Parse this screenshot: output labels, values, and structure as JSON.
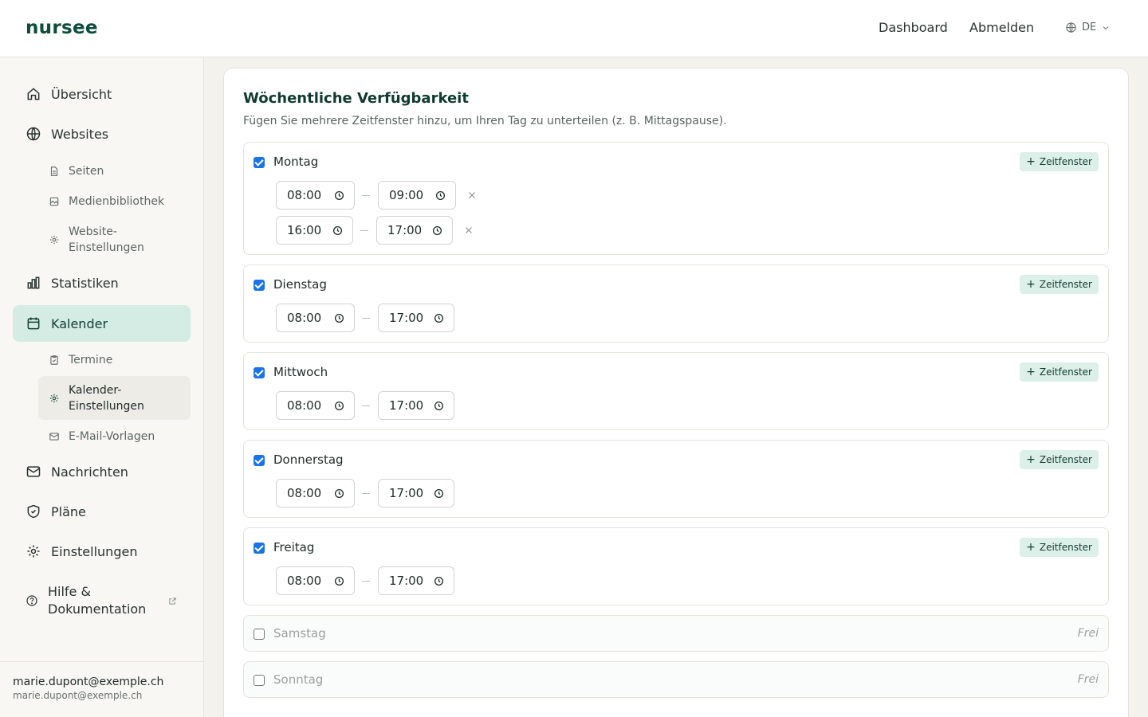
{
  "header": {
    "logo": "nursee",
    "nav": [
      {
        "label": "Dashboard"
      },
      {
        "label": "Abmelden"
      }
    ],
    "language": "DE"
  },
  "sidebar": {
    "items": [
      {
        "label": "Übersicht",
        "icon": "home-icon"
      },
      {
        "label": "Websites",
        "icon": "globe-icon"
      },
      {
        "label": "Seiten",
        "icon": "file-icon"
      },
      {
        "label": "Medienbibliothek",
        "icon": "image-icon"
      },
      {
        "label": "Website-",
        "label2": "Einstellungen",
        "icon": "gear-icon"
      },
      {
        "label": "Statistiken",
        "icon": "bar-chart-icon"
      },
      {
        "label": "Kalender",
        "icon": "calendar-icon"
      },
      {
        "label": "Termine",
        "icon": "clipboard-icon"
      },
      {
        "label": "Kalender-",
        "label2": "Einstellungen",
        "icon": "gear-icon"
      },
      {
        "label": "E-Mail-Vorlagen",
        "icon": "mail-icon"
      },
      {
        "label": "Nachrichten",
        "icon": "mail-icon"
      },
      {
        "label": "Pläne",
        "icon": "shield-icon"
      },
      {
        "label": "Einstellungen",
        "icon": "gear-icon"
      },
      {
        "label": "Hilfe &",
        "label2": "Dokumentation",
        "icon": "help-icon"
      }
    ],
    "user": {
      "name": "marie.dupont@exemple.ch",
      "email": "marie.dupont@exemple.ch"
    }
  },
  "availability": {
    "title": "Wöchentliche Verfügbarkeit",
    "subtitle": "Fügen Sie mehrere Zeitfenster hinzu, um Ihren Tag zu unterteilen (z. B. Mittagspause).",
    "add_label": "Zeitfenster",
    "off_label": "Frei",
    "days": [
      {
        "name": "Montag",
        "enabled": true,
        "slots": [
          {
            "start": "08:00",
            "end": "09:00"
          },
          {
            "start": "16:00",
            "end": "17:00"
          }
        ]
      },
      {
        "name": "Dienstag",
        "enabled": true,
        "slots": [
          {
            "start": "08:00",
            "end": "17:00"
          }
        ]
      },
      {
        "name": "Mittwoch",
        "enabled": true,
        "slots": [
          {
            "start": "08:00",
            "end": "17:00"
          }
        ]
      },
      {
        "name": "Donnerstag",
        "enabled": true,
        "slots": [
          {
            "start": "08:00",
            "end": "17:00"
          }
        ]
      },
      {
        "name": "Freitag",
        "enabled": true,
        "slots": [
          {
            "start": "08:00",
            "end": "17:00"
          }
        ]
      },
      {
        "name": "Samstag",
        "enabled": false,
        "slots": []
      },
      {
        "name": "Sonntag",
        "enabled": false,
        "slots": []
      }
    ]
  },
  "colors": {
    "brand": "#0e4d3c",
    "active_nav": "#d5ece4",
    "add_button": "#dcefe8",
    "checkbox": "#1a73e8"
  }
}
